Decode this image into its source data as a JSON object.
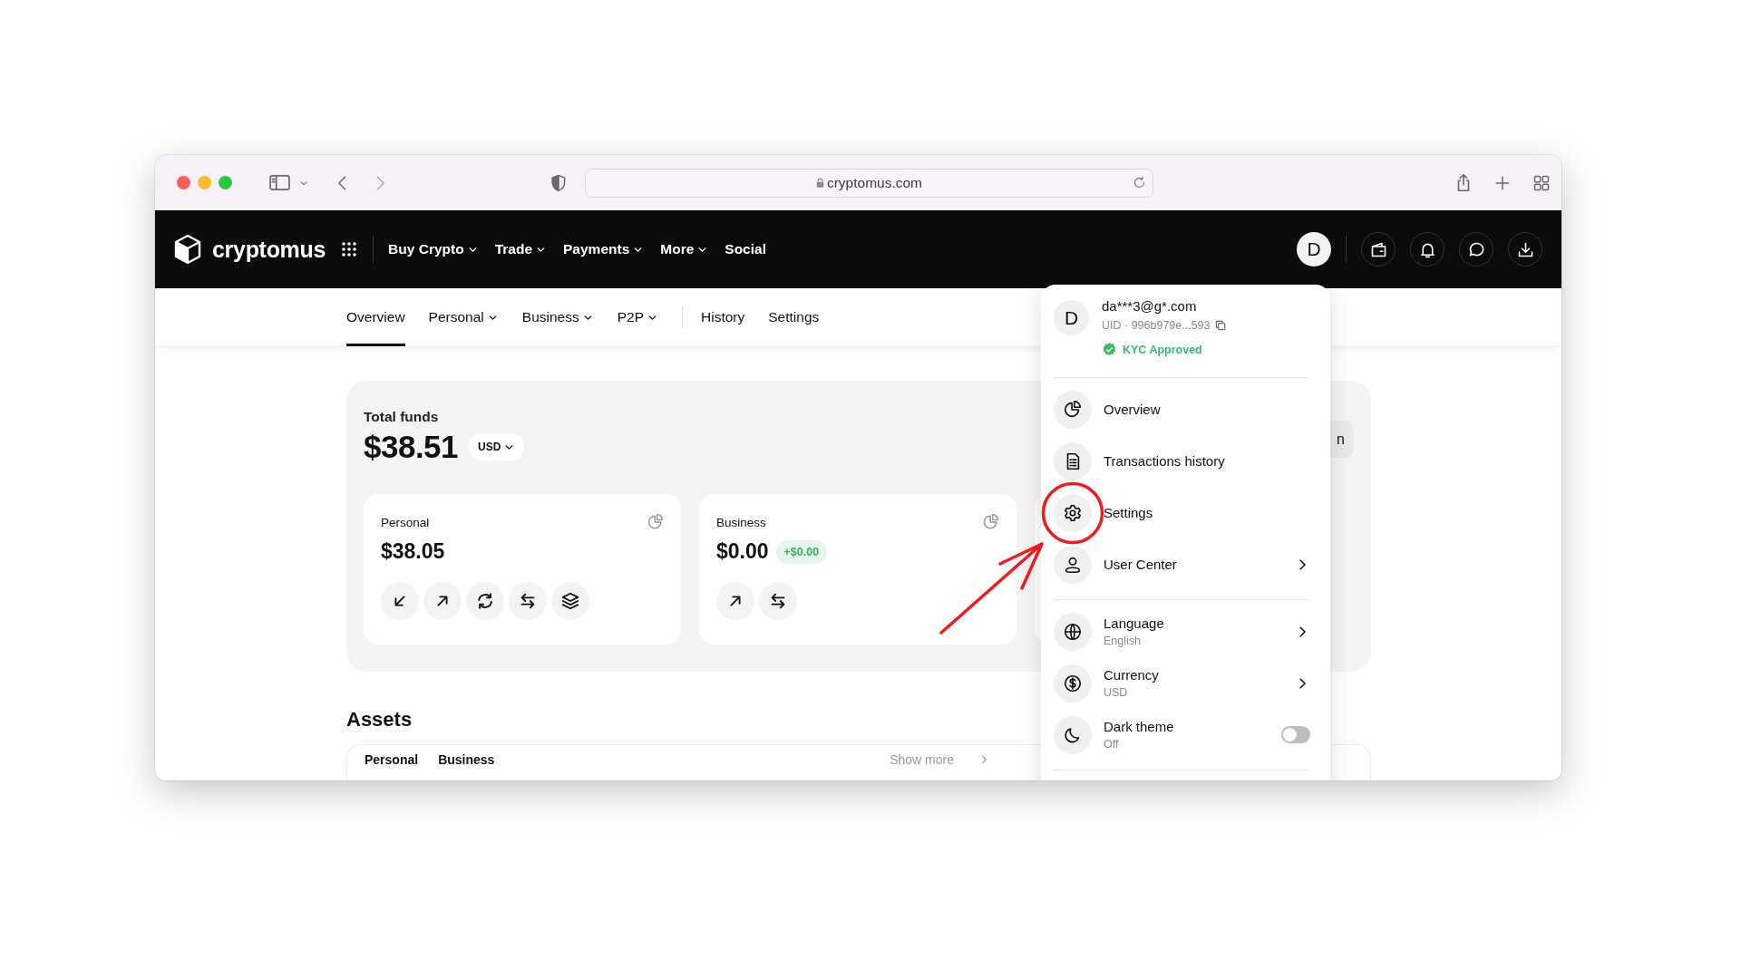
{
  "browser": {
    "url": "cryptomus.com"
  },
  "nav": {
    "logo": "cryptomus",
    "items": [
      {
        "label": "Buy Crypto",
        "dropdown": true
      },
      {
        "label": "Trade",
        "dropdown": true
      },
      {
        "label": "Payments",
        "dropdown": true
      },
      {
        "label": "More",
        "dropdown": true
      },
      {
        "label": "Social",
        "dropdown": false
      }
    ],
    "avatar": "D"
  },
  "subnav": {
    "primary": [
      {
        "label": "Overview",
        "dropdown": false,
        "selected": true
      },
      {
        "label": "Personal",
        "dropdown": true,
        "selected": false
      },
      {
        "label": "Business",
        "dropdown": true,
        "selected": false
      },
      {
        "label": "P2P",
        "dropdown": true,
        "selected": false
      }
    ],
    "secondary": [
      {
        "label": "History",
        "selected": false
      },
      {
        "label": "Settings",
        "selected": false
      }
    ]
  },
  "funds": {
    "title": "Total funds",
    "total": "$38.51",
    "currency": "USD",
    "side_button": "n",
    "accounts": [
      {
        "name": "Personal",
        "amount": "$38.05",
        "actions": [
          {
            "kind": "receive"
          },
          {
            "kind": "send"
          },
          {
            "kind": "convert"
          },
          {
            "kind": "transfer"
          },
          {
            "kind": "stake"
          }
        ]
      },
      {
        "name": "Business",
        "amount": "$0.00",
        "change": "+$0.00",
        "actions": [
          {
            "kind": "send"
          },
          {
            "kind": "transfer"
          }
        ]
      }
    ]
  },
  "assets": {
    "title": "Assets",
    "tabs": [
      "Personal",
      "Business"
    ],
    "show_more": "Show more"
  },
  "menu": {
    "avatar": "D",
    "email": "da***3@g*.com",
    "uid": "UID · 996b979e...593",
    "kyc": "KYC Approved",
    "sections": [
      [
        {
          "kind": "link",
          "label": "Overview",
          "highlighted": false
        },
        {
          "kind": "link",
          "label": "Transactions history",
          "highlighted": false
        },
        {
          "kind": "link",
          "label": "Settings",
          "highlighted": true
        },
        {
          "kind": "submenu",
          "label": "User Center",
          "highlighted": false
        }
      ],
      [
        {
          "kind": "submenu",
          "label": "Language",
          "sublabel": "English",
          "highlighted": false
        },
        {
          "kind": "submenu",
          "label": "Currency",
          "sublabel": "USD",
          "highlighted": false
        },
        {
          "kind": "toggle",
          "label": "Dark theme",
          "sublabel": "Off",
          "on": false,
          "highlighted": false
        }
      ]
    ]
  }
}
